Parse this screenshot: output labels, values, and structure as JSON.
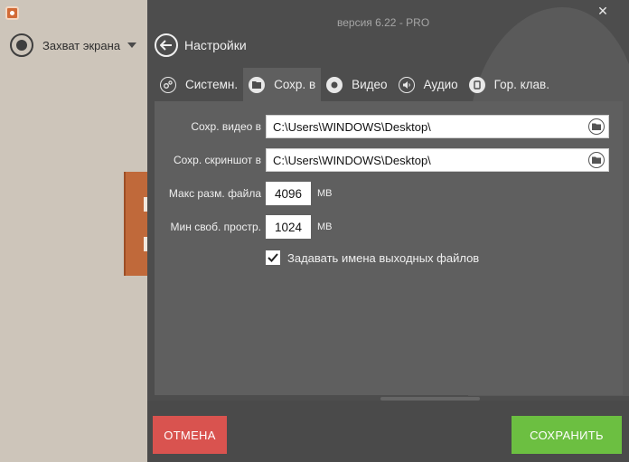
{
  "sidebar": {
    "capture_label": "Захват экрана"
  },
  "header": {
    "version": "версия 6.22 - PRO",
    "title": "Настройки",
    "close_glyph": "✕"
  },
  "tabs": [
    {
      "label": "Системн.",
      "icon": "gears-icon",
      "active": false
    },
    {
      "label": "Сохр. в",
      "icon": "folder-icon",
      "active": true
    },
    {
      "label": "Видео",
      "icon": "record-icon",
      "active": false
    },
    {
      "label": "Аудио",
      "icon": "speaker-icon",
      "active": false
    },
    {
      "label": "Гор. клав.",
      "icon": "hotkey-icon",
      "active": false
    }
  ],
  "save_to": {
    "video_label": "Сохр. видео в",
    "video_path": "C:\\Users\\WINDOWS\\Desktop\\",
    "screenshot_label": "Сохр. скриншот в",
    "screenshot_path": "C:\\Users\\WINDOWS\\Desktop\\",
    "max_size_label": "Макс разм. файла",
    "max_size_value": "4096",
    "max_size_unit": "МВ",
    "min_free_label": "Мин своб. простр.",
    "min_free_value": "1024",
    "min_free_unit": "МВ",
    "name_files_label": "Задавать имена выходных файлов",
    "name_files_checked": true
  },
  "footer": {
    "cancel_label": "ОТМЕНА",
    "save_label": "СОХРАНИТЬ"
  },
  "colors": {
    "panel_bg": "#4d4d4d",
    "content_bg": "#5f5f5f",
    "cancel": "#d9534f",
    "save": "#6cbf41"
  }
}
